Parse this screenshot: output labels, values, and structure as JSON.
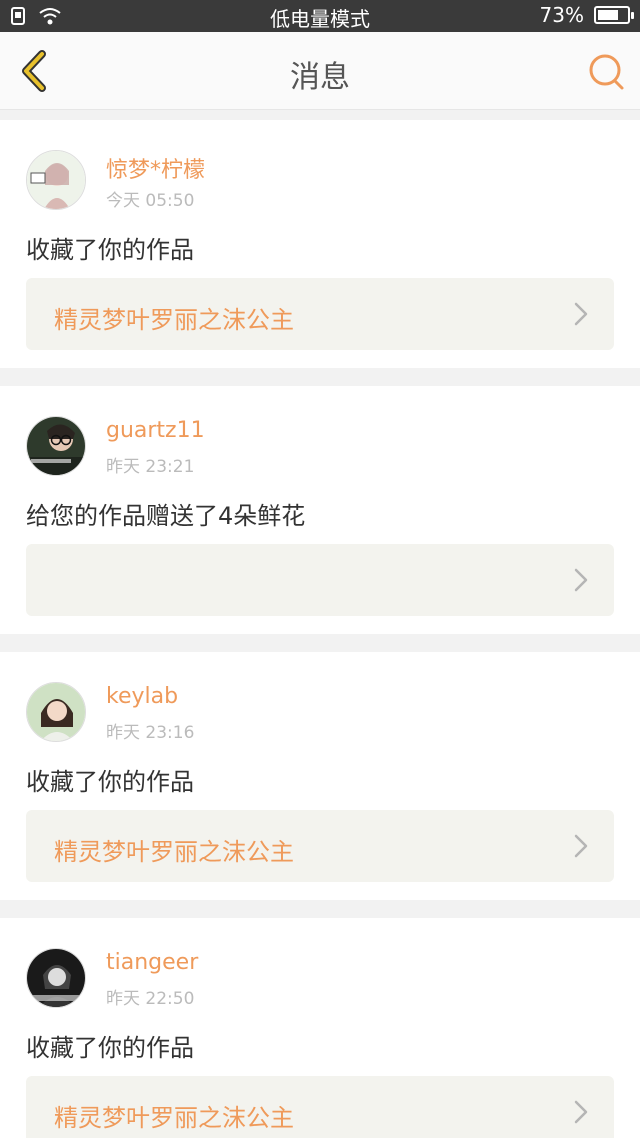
{
  "status_bar": {
    "mode_text": "低电量模式",
    "battery_text": "73%",
    "battery_level": 0.73
  },
  "header": {
    "title": "消息",
    "back_icon": "chevron-left-icon",
    "search_icon": "search-icon"
  },
  "colors": {
    "accent": "#ef9a5a",
    "back": "#e8c12c"
  },
  "messages": [
    {
      "username": "惊梦*柠檬",
      "time": "今天 05:50",
      "action": "收藏了你的作品",
      "work": "精灵梦叶罗丽之沫公主"
    },
    {
      "username": "guartz11",
      "time": "昨天 23:21",
      "action": "给您的作品赠送了4朵鲜花",
      "work": ""
    },
    {
      "username": "keylab",
      "time": "昨天 23:16",
      "action": "收藏了你的作品",
      "work": "精灵梦叶罗丽之沫公主"
    },
    {
      "username": "tiangeer",
      "time": "昨天 22:50",
      "action": "收藏了你的作品",
      "work": "精灵梦叶罗丽之沫公主"
    }
  ]
}
